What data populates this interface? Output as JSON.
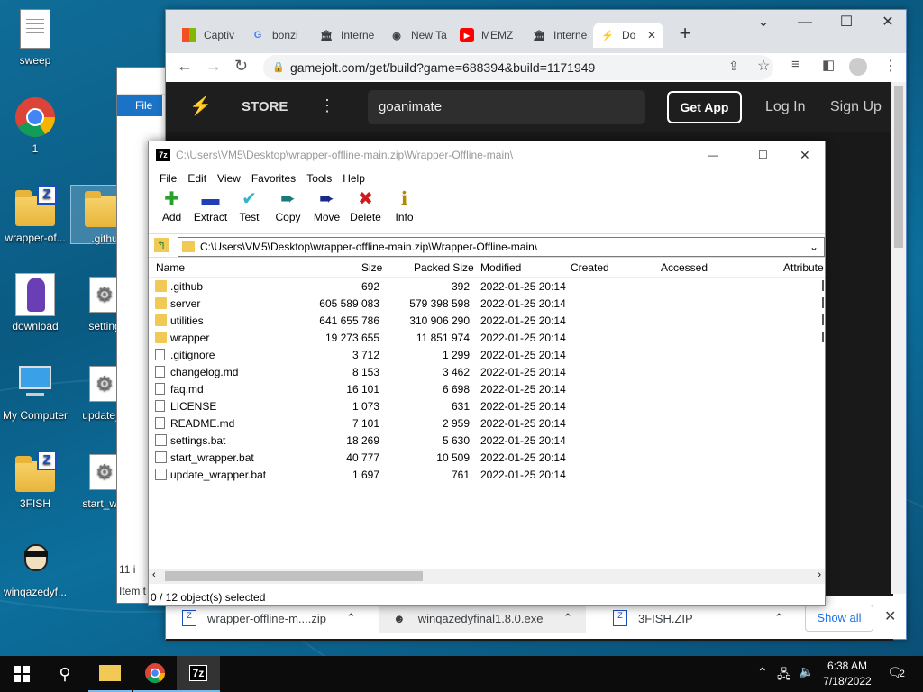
{
  "desktop": {
    "icons": [
      {
        "label": "sweep",
        "kind": "doc"
      },
      {
        "label": "1",
        "kind": "chrome"
      },
      {
        "label": "wrapper-of...",
        "kind": "zipfolder"
      },
      {
        "label": ".githu",
        "kind": "folder"
      },
      {
        "label": "download",
        "kind": "image"
      },
      {
        "label": "setting",
        "kind": "gear"
      },
      {
        "label": "My Computer",
        "kind": "computer"
      },
      {
        "label": "update_v",
        "kind": "gear"
      },
      {
        "label": "3FISH",
        "kind": "zipfolder"
      },
      {
        "label": "start_wra",
        "kind": "gear"
      },
      {
        "label": "winqazedyf...",
        "kind": "face"
      }
    ]
  },
  "explorer": {
    "count_text": "11 i",
    "status_text": "Item t",
    "file_label": "File"
  },
  "chrome": {
    "tabs": [
      "Captiv",
      "bonzi",
      "Interne",
      "New Ta",
      "MEMZ",
      "Interne",
      "Do"
    ],
    "url": "gamejolt.com/get/build?game=688394&build=1171949",
    "page": {
      "store": "STORE",
      "search_value": "goanimate",
      "get_app": "Get App",
      "login": "Log In",
      "signup": "Sign Up"
    },
    "downloads": [
      {
        "name": "wrapper-offline-m....zip"
      },
      {
        "name": "winqazedyfinal1.8.0.exe"
      },
      {
        "name": "3FISH.ZIP"
      }
    ],
    "show_all": "Show all"
  },
  "zip": {
    "title": "C:\\Users\\VM5\\Desktop\\wrapper-offline-main.zip\\Wrapper-Offline-main\\",
    "menu": [
      "File",
      "Edit",
      "View",
      "Favorites",
      "Tools",
      "Help"
    ],
    "tools": [
      {
        "label": "Add",
        "glyph": "✚",
        "color": "#2ca02c"
      },
      {
        "label": "Extract",
        "glyph": "▬",
        "color": "#1f3fb4"
      },
      {
        "label": "Test",
        "glyph": "✔",
        "color": "#2bb6c9"
      },
      {
        "label": "Copy",
        "glyph": "➨",
        "color": "#1a7a7a"
      },
      {
        "label": "Move",
        "glyph": "➨",
        "color": "#1a2a8a"
      },
      {
        "label": "Delete",
        "glyph": "✖",
        "color": "#d11a1a"
      },
      {
        "label": "Info",
        "glyph": "ℹ",
        "color": "#b08a00"
      }
    ],
    "path": "C:\\Users\\VM5\\Desktop\\wrapper-offline-main.zip\\Wrapper-Offline-main\\",
    "columns": [
      "Name",
      "Size",
      "Packed Size",
      "Modified",
      "Created",
      "Accessed",
      "Attribute"
    ],
    "rows": [
      {
        "name": ".github",
        "size": "692",
        "packed": "392",
        "modified": "2022-01-25 20:14",
        "type": "f"
      },
      {
        "name": "server",
        "size": "605 589 083",
        "packed": "579 398 598",
        "modified": "2022-01-25 20:14",
        "type": "f"
      },
      {
        "name": "utilities",
        "size": "641 655 786",
        "packed": "310 906 290",
        "modified": "2022-01-25 20:14",
        "type": "f"
      },
      {
        "name": "wrapper",
        "size": "19 273 655",
        "packed": "11 851 974",
        "modified": "2022-01-25 20:14",
        "type": "f"
      },
      {
        "name": ".gitignore",
        "size": "3 712",
        "packed": "1 299",
        "modified": "2022-01-25 20:14",
        "type": "d"
      },
      {
        "name": "changelog.md",
        "size": "8 153",
        "packed": "3 462",
        "modified": "2022-01-25 20:14",
        "type": "d"
      },
      {
        "name": "faq.md",
        "size": "16 101",
        "packed": "6 698",
        "modified": "2022-01-25 20:14",
        "type": "d"
      },
      {
        "name": "LICENSE",
        "size": "1 073",
        "packed": "631",
        "modified": "2022-01-25 20:14",
        "type": "d"
      },
      {
        "name": "README.md",
        "size": "7 101",
        "packed": "2 959",
        "modified": "2022-01-25 20:14",
        "type": "d"
      },
      {
        "name": "settings.bat",
        "size": "18 269",
        "packed": "5 630",
        "modified": "2022-01-25 20:14",
        "type": "b"
      },
      {
        "name": "start_wrapper.bat",
        "size": "40 777",
        "packed": "10 509",
        "modified": "2022-01-25 20:14",
        "type": "b"
      },
      {
        "name": "update_wrapper.bat",
        "size": "1 697",
        "packed": "761",
        "modified": "2022-01-25 20:14",
        "type": "b"
      }
    ],
    "status": "0 / 12 object(s) selected"
  },
  "taskbar": {
    "time": "6:38 AM",
    "date": "7/18/2022",
    "notifications": "2",
    "app_7z": "7z"
  }
}
